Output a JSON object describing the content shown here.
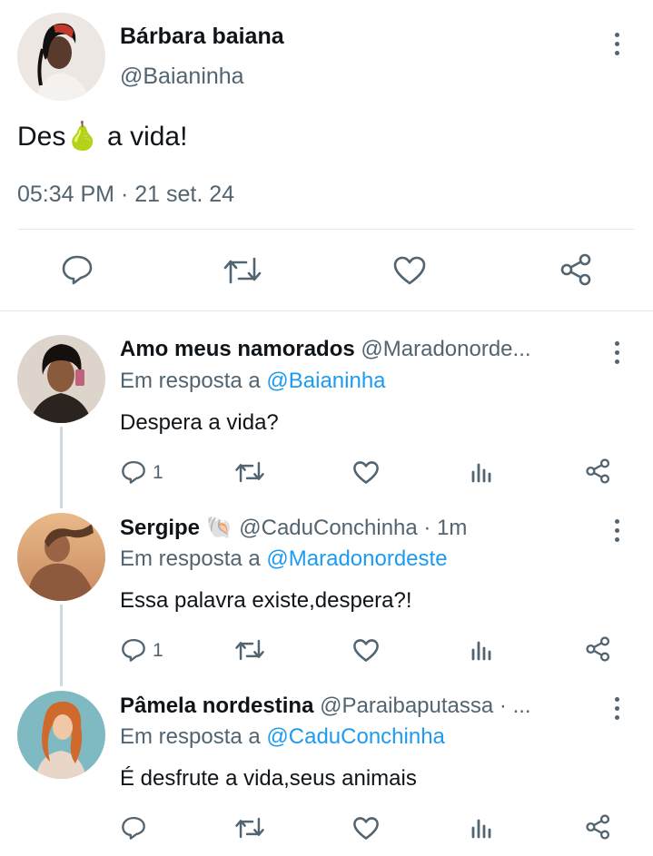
{
  "main_tweet": {
    "author_name": "Bárbara baiana",
    "author_handle": "@Baianinha",
    "text_before": "Des",
    "emoji": "🍐",
    "text_after": " a vida!",
    "timestamp": "05:34 PM · 21 set. 24",
    "actions": [
      "reply-icon",
      "retweet-icon",
      "like-icon",
      "share-icon"
    ]
  },
  "replies": [
    {
      "author_name": "Amo meus namorados",
      "author_handle": "@Maradonorde...",
      "reply_prefix": "Em resposta a ",
      "reply_to": "@Baianinha",
      "text": "Despera a vida?",
      "reply_count": "1"
    },
    {
      "author_name": "Sergipe",
      "name_emoji": "🐚",
      "author_handle": "@CaduConchinha · 1m",
      "reply_prefix": "Em resposta a ",
      "reply_to": "@Maradonordeste",
      "text": "Essa palavra existe,despera?!",
      "reply_count": "1"
    },
    {
      "author_name": "Pâmela nordestina",
      "author_handle": "@Paraibaputassa · ...",
      "reply_prefix": "Em resposta a ",
      "reply_to": "@CaduConchinha",
      "text": "É desfrute a vida,seus animais",
      "reply_count": ""
    }
  ],
  "colors": {
    "link_blue": "#1d9bf0",
    "icon_grey": "#536471",
    "thread_line": "#cfd9de"
  }
}
